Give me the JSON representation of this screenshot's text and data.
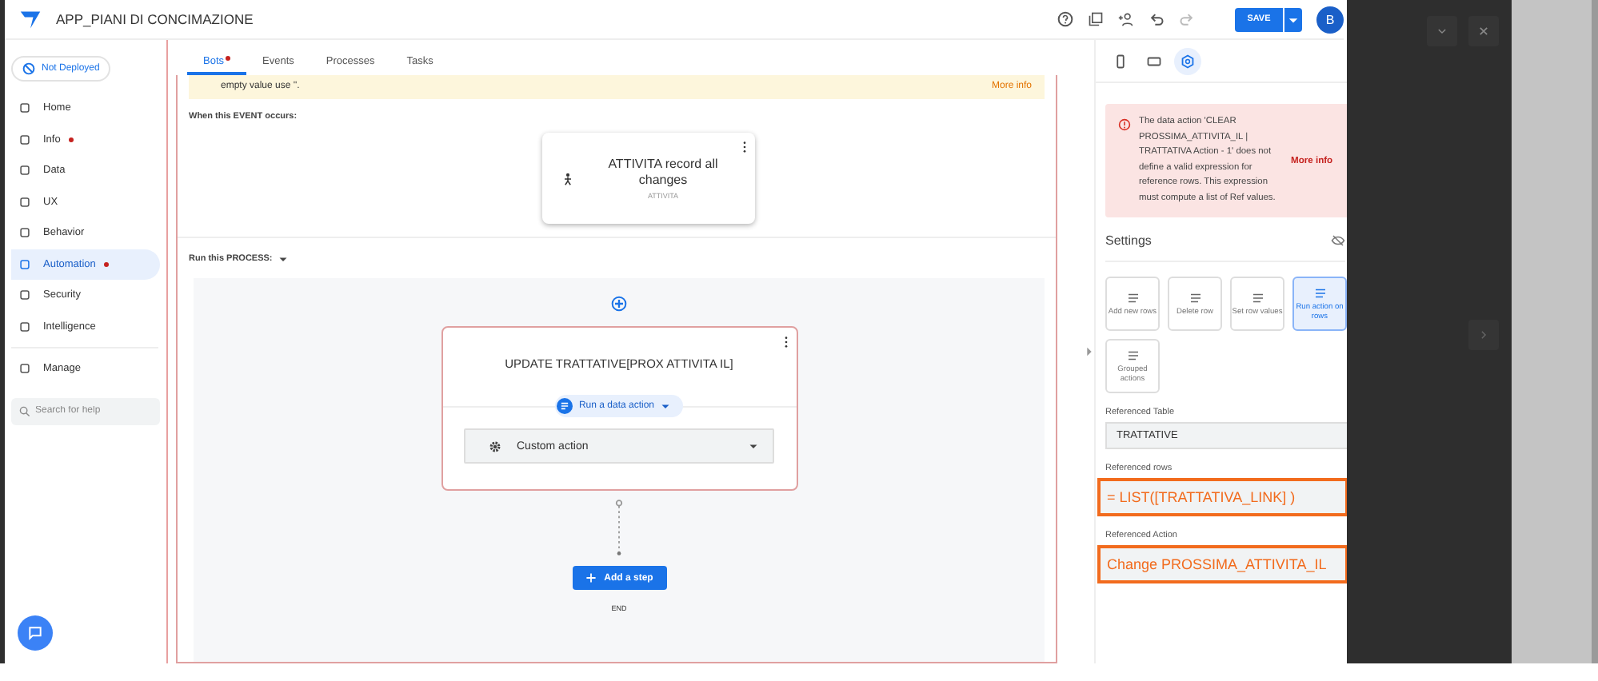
{
  "app": {
    "title": "APP_PIANI DI CONCIMAZIONE",
    "save_label": "SAVE",
    "avatar_letter": "B"
  },
  "sidebar": {
    "deploy_status": "Not Deployed",
    "items": [
      {
        "label": "Home",
        "selected": false,
        "alert": false
      },
      {
        "label": "Info",
        "selected": false,
        "alert": true
      },
      {
        "label": "Data",
        "selected": false,
        "alert": false
      },
      {
        "label": "UX",
        "selected": false,
        "alert": false
      },
      {
        "label": "Behavior",
        "selected": false,
        "alert": false
      },
      {
        "label": "Automation",
        "selected": true,
        "alert": true
      },
      {
        "label": "Security",
        "selected": false,
        "alert": false
      },
      {
        "label": "Intelligence",
        "selected": false,
        "alert": false
      },
      {
        "label": "Manage",
        "selected": false,
        "alert": false
      }
    ],
    "search": {
      "placeholder": "Search for help"
    }
  },
  "tabs": [
    {
      "label": "Bots",
      "selected": true,
      "alert": true
    },
    {
      "label": "Events",
      "selected": false,
      "alert": false
    },
    {
      "label": "Processes",
      "selected": false,
      "alert": false
    },
    {
      "label": "Tasks",
      "selected": false,
      "alert": false
    }
  ],
  "bot": {
    "warning": {
      "text": "empty value use ''.",
      "link": "More info"
    },
    "event_heading": "When this EVENT occurs:",
    "event": {
      "title": "ATTIVITA record all changes",
      "table": "ATTIVITA"
    },
    "process_heading": "Run this PROCESS:",
    "step": {
      "title": "UPDATE TRATTATIVE[PROX ATTIVITA IL]",
      "type": "Run a data action",
      "action": "Custom action"
    },
    "add_step": "Add a step",
    "end": "END"
  },
  "panel": {
    "error": {
      "text": "The data action 'CLEAR PROSSIMA_ATTIVITA_IL | TRATTATIVA Action - 1' does not define a valid expression for reference rows. This expression must compute a list of Ref values.",
      "link": "More info"
    },
    "settings_heading": "Settings",
    "actions": [
      {
        "label": "Add new rows",
        "selected": false
      },
      {
        "label": "Delete row",
        "selected": false
      },
      {
        "label": "Set row values",
        "selected": false
      },
      {
        "label": "Run action on rows",
        "selected": true
      },
      {
        "label": "Grouped actions",
        "selected": false
      }
    ],
    "fields": [
      {
        "label": "Referenced Table",
        "value": "TRATTATIVE",
        "highlighted": false
      },
      {
        "label": "Referenced rows",
        "value": "= LIST([TRATTATIVA_LINK] )",
        "highlighted": true
      },
      {
        "label": "Referenced Action",
        "value": "Change PROSSIMA_ATTIVITA_IL",
        "highlighted": true
      }
    ]
  }
}
